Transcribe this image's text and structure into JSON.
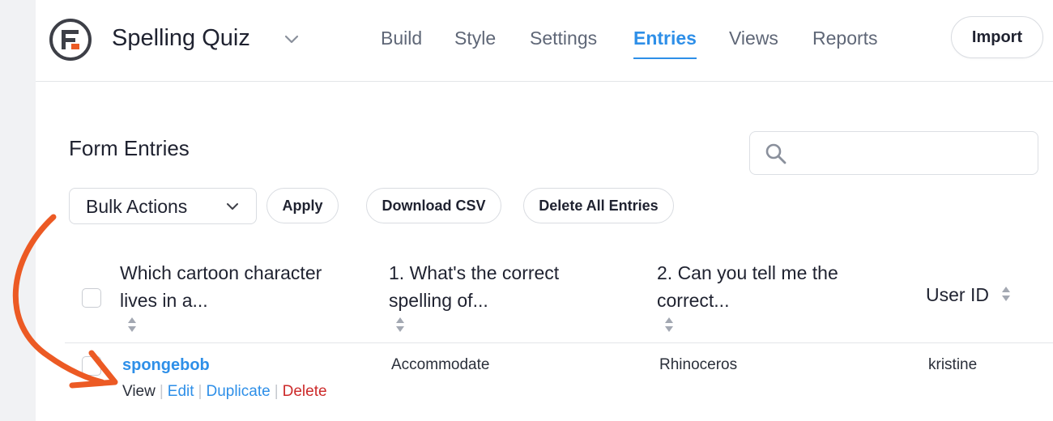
{
  "header": {
    "form_title": "Spelling Quiz",
    "nav": [
      {
        "label": "Build",
        "active": false
      },
      {
        "label": "Style",
        "active": false
      },
      {
        "label": "Settings",
        "active": false
      },
      {
        "label": "Entries",
        "active": true
      },
      {
        "label": "Views",
        "active": false
      },
      {
        "label": "Reports",
        "active": false
      }
    ],
    "import_label": "Import"
  },
  "page": {
    "title": "Form Entries",
    "search": {
      "value": "",
      "placeholder": ""
    }
  },
  "toolbar": {
    "bulk_actions": "Bulk Actions",
    "apply": "Apply",
    "download_csv": "Download CSV",
    "delete_all": "Delete All Entries"
  },
  "table": {
    "columns": [
      {
        "line1": "Which cartoon character",
        "line2": "lives in a..."
      },
      {
        "line1": "1. What's the correct",
        "line2": "spelling of..."
      },
      {
        "line1": "2. Can you tell me the",
        "line2": "correct..."
      },
      {
        "label": "User ID"
      }
    ],
    "rows": [
      {
        "answer": "spongebob",
        "q1": "Accommodate",
        "q2": "Rhinoceros",
        "user_id": "kristine",
        "actions": {
          "view": "View",
          "edit": "Edit",
          "duplicate": "Duplicate",
          "delete": "Delete"
        }
      }
    ]
  },
  "icons": [
    "formidable-logo-icon",
    "chevron-down-icon",
    "search-icon",
    "sort-icon",
    "curved-arrow-annotation"
  ],
  "colors": {
    "accent": "#2e8fe8",
    "delete": "#cc2a2a",
    "annotation_arrow": "#ec5a24",
    "text": "#1f2230"
  }
}
